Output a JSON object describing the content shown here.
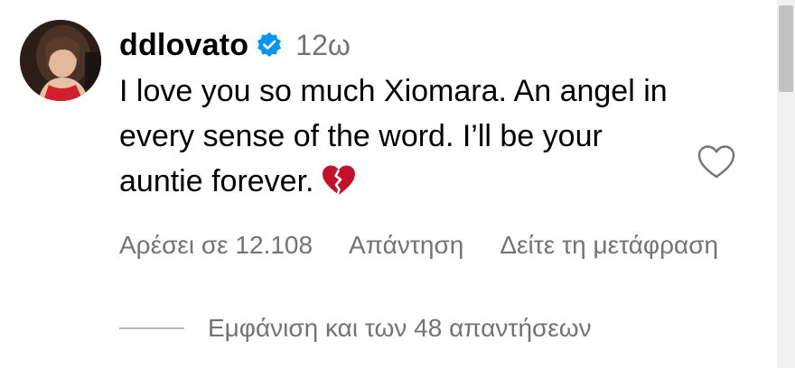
{
  "comment": {
    "username": "ddlovato",
    "verified": true,
    "time": "12ω",
    "text": "I love you so much Xiomara. An angel in every sense of the word. I’ll be your auntie forever.",
    "emoji": "broken-heart-icon"
  },
  "actions": {
    "likes": "Αρέσει σε 12.108",
    "reply": "Απάντηση",
    "translate": "Δείτε τη μετάφραση"
  },
  "replies": {
    "view_label": "Εμφάνιση και των 48 απαντήσεων"
  },
  "colors": {
    "verified_badge": "#0095f6",
    "muted_text": "#737373",
    "broken_heart": "#c4112b"
  }
}
